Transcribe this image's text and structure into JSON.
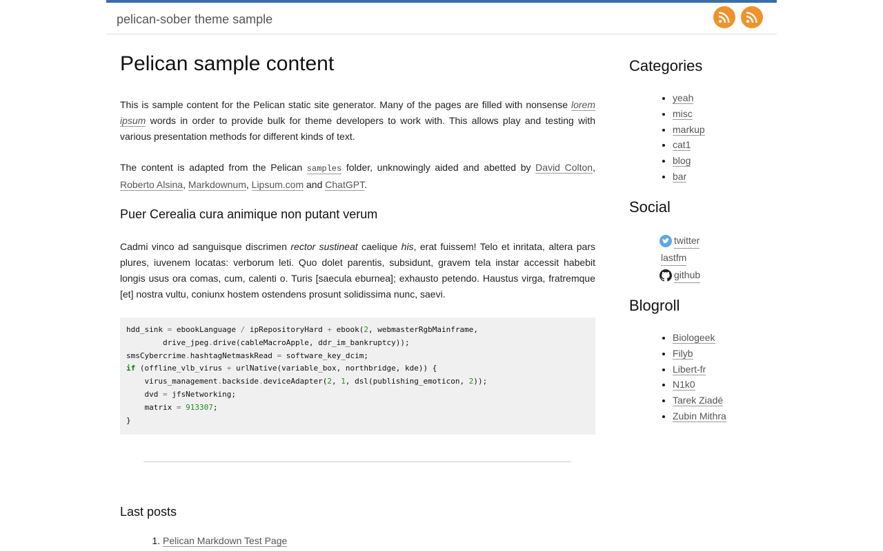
{
  "header": {
    "site_title": "pelican-sober theme sample",
    "feeds": [
      "rss-icon",
      "rss-icon"
    ],
    "accent_color": "#3a6ea5",
    "feed_color": "#f0922b"
  },
  "article": {
    "title": "Pelican sample content",
    "p1_text": "This is sample content for the Pelican static site generator. Many of the pages are filled with nonsense ",
    "p1_link": "lorem ipsum",
    "p1_rest": " words in order to provide bulk for theme developers to work with. This allows play and testing with various presentation methods for different kinds of text.",
    "p2_text": "The content is adapted from the Pelican ",
    "p2_code": "samples",
    "p2_mid": " folder, unknowingly aided and abetted by ",
    "p2_links": [
      "David Colton",
      "Roberto Alsina",
      "Markdownum",
      "Lipsum.com",
      "ChatGPT"
    ],
    "p2_and": " and ",
    "subheading": "Puer Cerealia cura animique non putant verum",
    "p3_a": "Cadmi vinco ad sanguisque discrimen ",
    "p3_em1": "rector sustineat",
    "p3_b": " caelique ",
    "p3_em2": "his",
    "p3_c": ", erat fuissem! Telo et inritata, altera pars plures, iuvenem locatas: verborum leti. Quo dolet parentis, subsidunt, gravem tela instar accessit habebit longis usus ora comas, cum, calenti o. Turis [saecula eburnea]; exhausto petendo. Haustus virga, fratremque [et] nostra vultu, coniunx hostem ostendens prosunt solidissima nunc, saevi."
  },
  "last_posts": {
    "heading": "Last posts",
    "items": [
      "Pelican Markdown Test Page"
    ]
  },
  "sidebar": {
    "categories_heading": "Categories",
    "categories": [
      "yeah",
      "misc",
      "markup",
      "cat1",
      "blog",
      "bar"
    ],
    "social_heading": "Social",
    "social": [
      {
        "label": "twitter",
        "icon": "twitter-icon"
      },
      {
        "label": "lastfm",
        "icon": ""
      },
      {
        "label": "github",
        "icon": "github-icon"
      }
    ],
    "blogroll_heading": "Blogroll",
    "blogroll": [
      "Biologeek",
      "Filyb",
      "Libert-fr",
      "N1k0",
      "Tarek Ziadé",
      "Zubin Mithra"
    ]
  }
}
